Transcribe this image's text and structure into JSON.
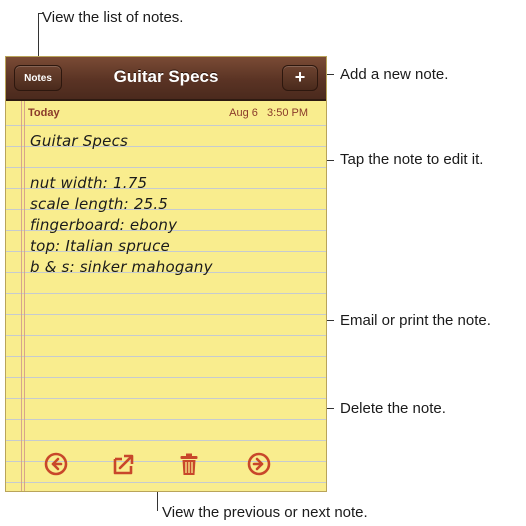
{
  "callouts": {
    "list_of_notes": "View the list of notes.",
    "add_note": "Add a new note.",
    "tap_note": "Tap the note to edit it.",
    "email_print": "Email or print the note.",
    "delete_note": "Delete the note.",
    "prev_next": "View the previous or next note."
  },
  "navbar": {
    "back_label": "Notes",
    "title": "Guitar Specs",
    "add_label": "+"
  },
  "note": {
    "date_label": "Today",
    "date": "Aug 6",
    "time": "3:50 PM",
    "lines": [
      "Guitar Specs",
      "",
      "nut width:  1.75",
      "scale length:  25.5",
      "fingerboard:  ebony",
      "top:  Italian spruce",
      "b & s:  sinker mahogany"
    ]
  },
  "toolbar": {
    "icons": [
      "previous-icon",
      "share-icon",
      "trash-icon",
      "next-icon"
    ]
  },
  "colors": {
    "navbar": "#5a3324",
    "paper": "#f9ed8e",
    "icon": "#c8472a",
    "date_text": "#8a3a2a"
  }
}
